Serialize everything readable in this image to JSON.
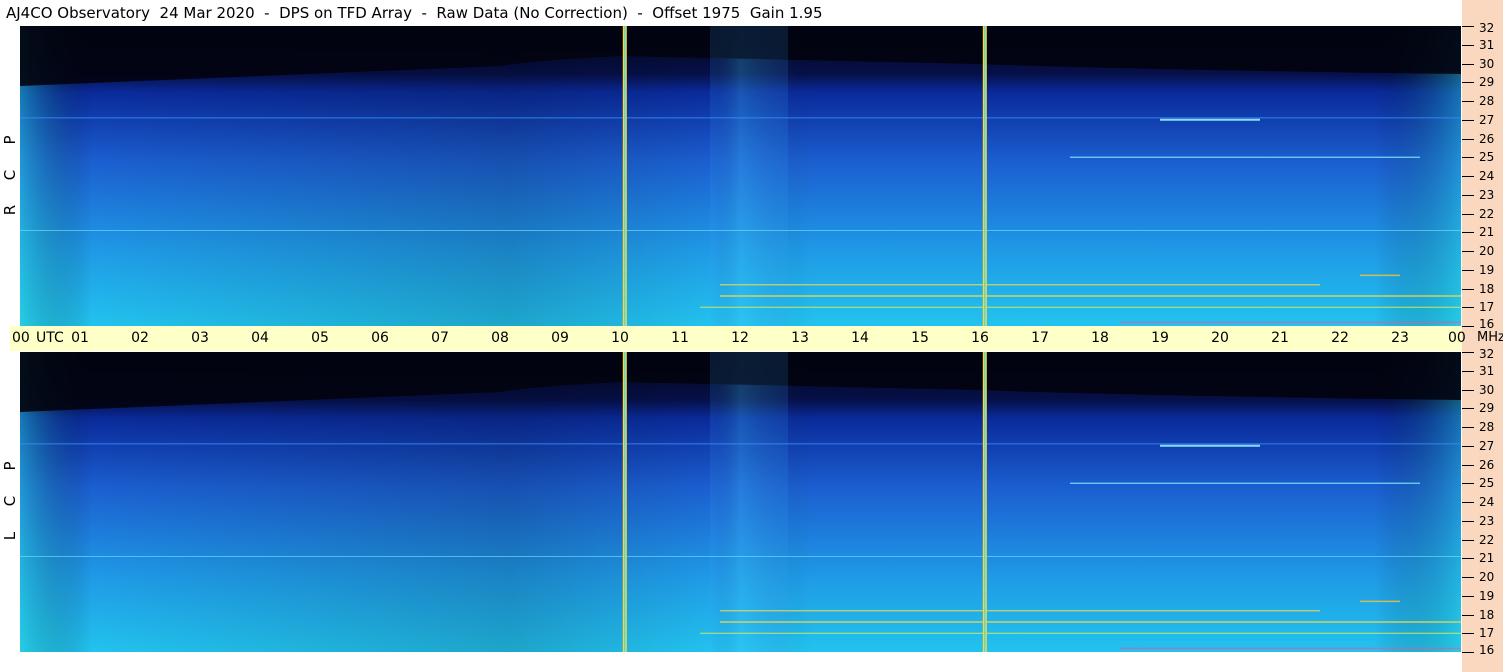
{
  "title": "AJ4CO Observatory  24 Mar 2020  -  DPS on TFD Array  -  Raw Data (No Correction)  -  Offset 1975  Gain 1.95",
  "time_axis": {
    "utc_label": "UTC",
    "hours": [
      "00",
      "01",
      "02",
      "03",
      "04",
      "05",
      "06",
      "07",
      "08",
      "09",
      "10",
      "11",
      "12",
      "13",
      "14",
      "15",
      "16",
      "17",
      "18",
      "19",
      "20",
      "21",
      "22",
      "23"
    ],
    "end_label": "00",
    "unit_label": "MHz"
  },
  "frequency_axis": {
    "ticks": [
      "32",
      "31",
      "30",
      "29",
      "28",
      "27",
      "26",
      "25",
      "24",
      "23",
      "22",
      "21",
      "20",
      "19",
      "18",
      "17",
      "16"
    ]
  },
  "panels": [
    {
      "id": "rcp",
      "letters": [
        "R",
        "C",
        "P"
      ]
    },
    {
      "id": "lcp",
      "letters": [
        "L",
        "C",
        "P"
      ]
    }
  ],
  "chart_data": {
    "type": "heatmap",
    "title": "AJ4CO Observatory  24 Mar 2020  -  DPS on TFD Array  -  Raw Data (No Correction)  -  Offset 1975  Gain 1.95",
    "x_axis": {
      "label": "UTC",
      "range": [
        0,
        24
      ],
      "unit": "hours"
    },
    "y_axis": {
      "label": "MHz",
      "range": [
        16,
        32
      ]
    },
    "series": [
      {
        "name": "RCP"
      },
      {
        "name": "LCP"
      }
    ],
    "markers_utc": [
      10.08,
      16.08
    ],
    "colors": {
      "low": "#050a30",
      "mid": "#1f6fd8",
      "high": "#2fd2ec",
      "rfi": "#f2d84a"
    }
  }
}
